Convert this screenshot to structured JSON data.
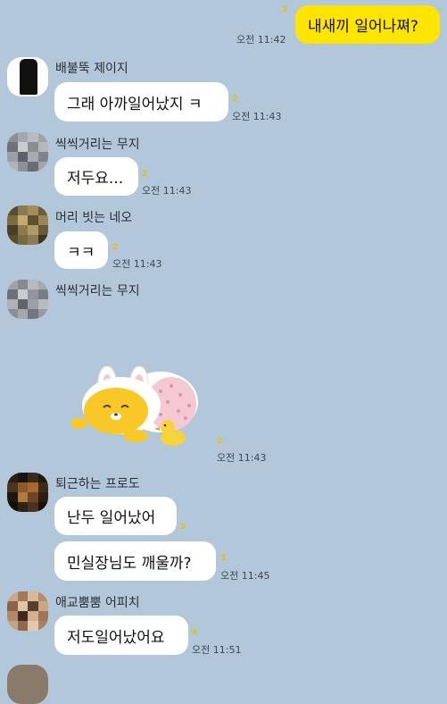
{
  "chat": {
    "messages": [
      {
        "type": "out",
        "text": "내새끼 일어나쪄?",
        "unread": "2",
        "time": "오전 11:42"
      },
      {
        "type": "in",
        "sender": "배불뚝 제이지",
        "text": "그래 아까일어났지 ㅋ",
        "unread": "2",
        "time": "오전 11:43"
      },
      {
        "type": "in",
        "sender": "씩씩거리는 무지",
        "text": "저두요...",
        "unread": "2",
        "time": "오전 11:43"
      },
      {
        "type": "in",
        "sender": "머리 빗는 네오",
        "text": "ㅋㅋ",
        "unread": "2",
        "time": "오전 11:43"
      },
      {
        "type": "in",
        "sender": "씩씩거리는 무지",
        "sticker": "lying-lion-bunny-sticker",
        "unread": "2",
        "time": "오전 11:43"
      },
      {
        "type": "in",
        "sender": "퇴근하는 프로도",
        "text": "난두 일어났어",
        "unread": "3"
      },
      {
        "type": "in",
        "text": "민실장님도 깨울까?",
        "unread": "3",
        "time": "오전 11:45"
      },
      {
        "type": "in",
        "sender": "애교뿜뿜 어피치",
        "text": "저도일어났어요",
        "unread": "4",
        "time": "오전 11:51"
      }
    ]
  }
}
